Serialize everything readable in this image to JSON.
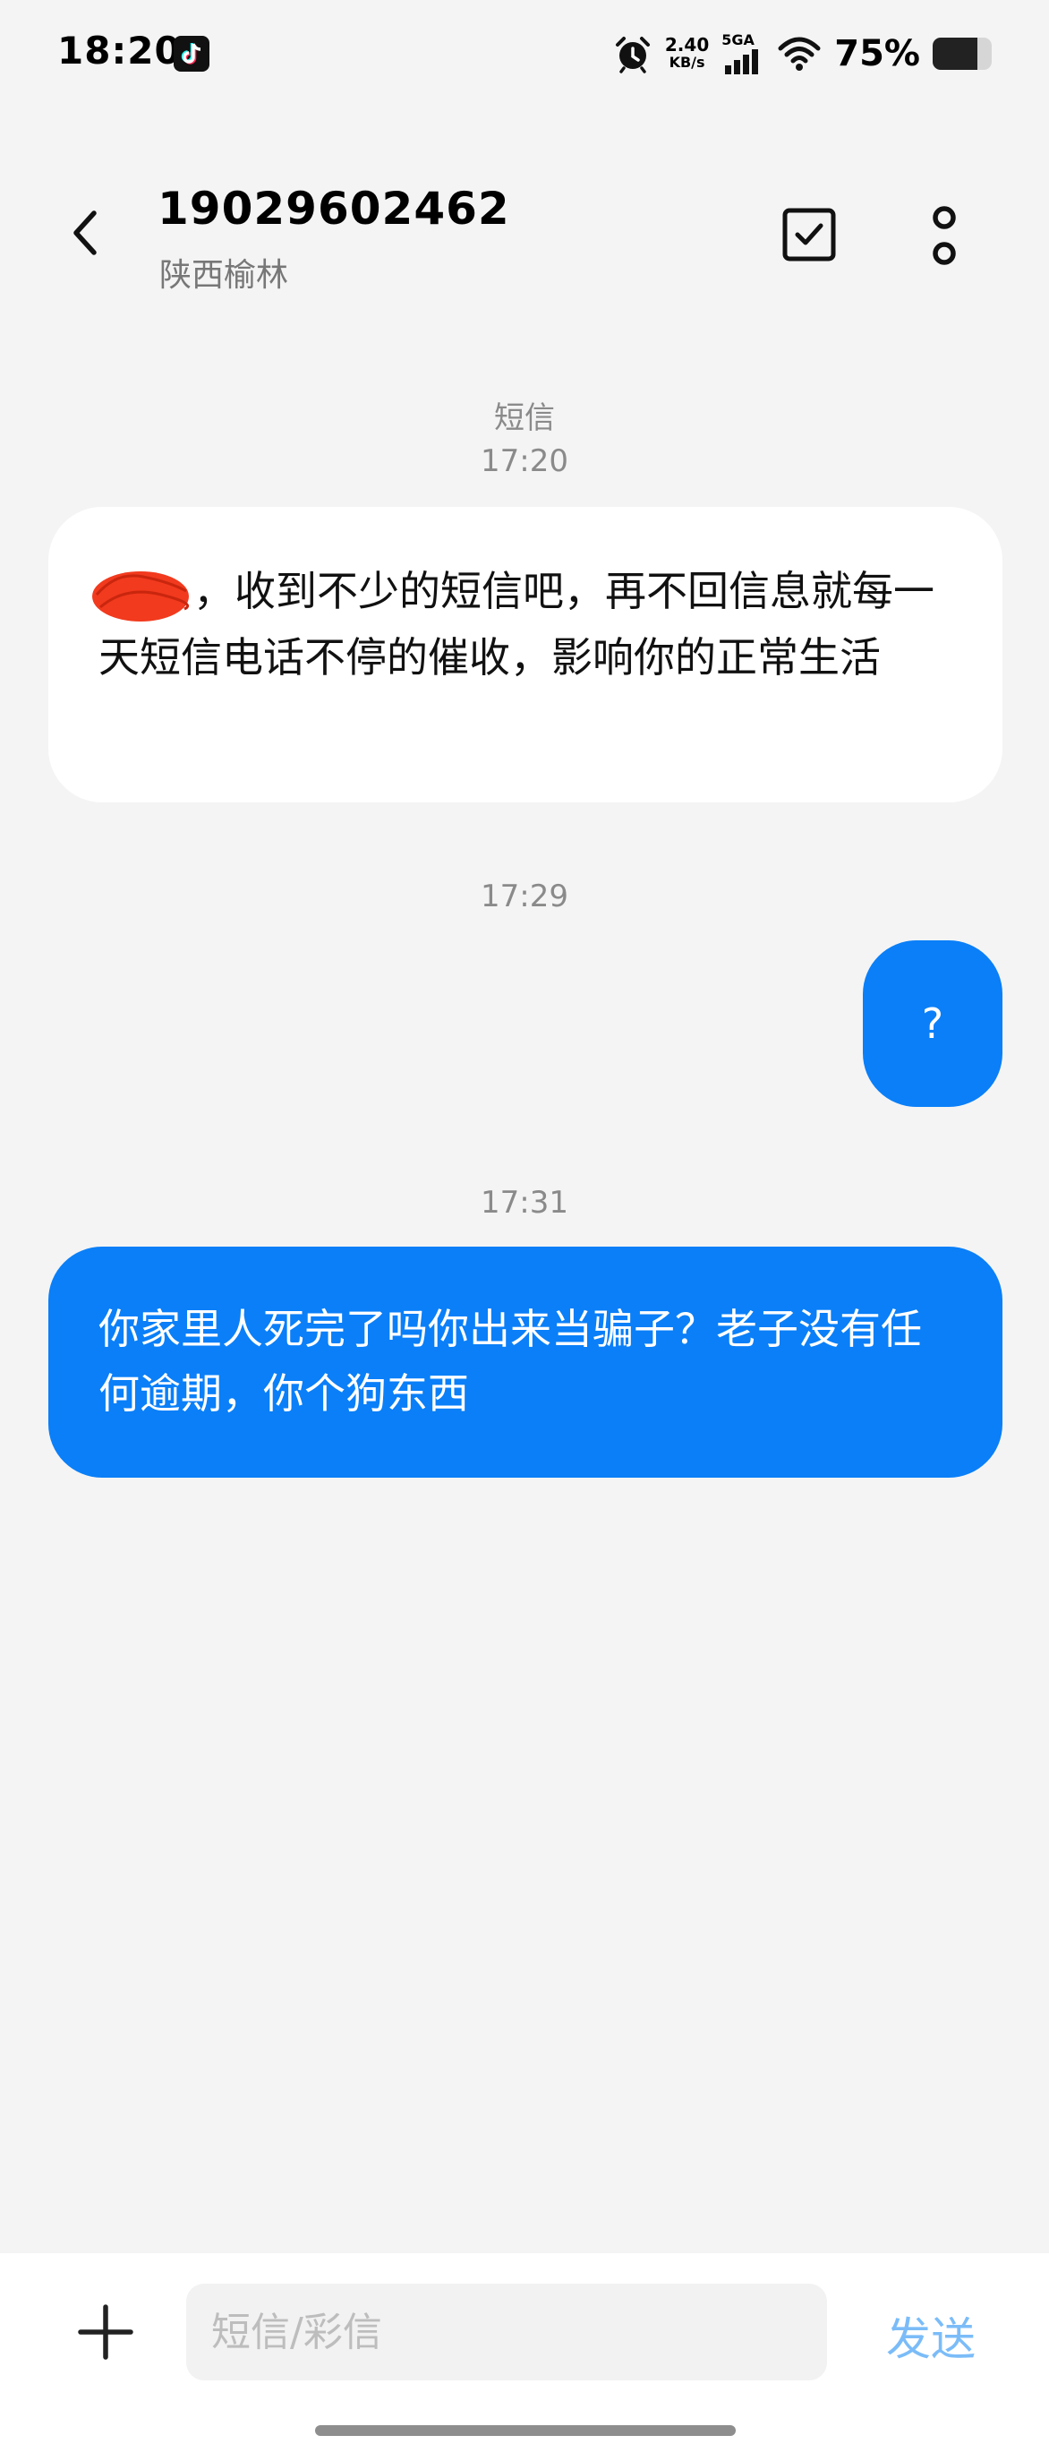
{
  "status_bar": {
    "time": "18:20",
    "net_speed_value": "2.40",
    "net_speed_unit": "KB/s",
    "signal_label": "5GA",
    "battery_percent_text": "75%",
    "battery_level": 0.75
  },
  "header": {
    "contact_number": "19029602462",
    "contact_location": "陕西榆林"
  },
  "messages": {
    "channel_label": "短信",
    "groups": [
      {
        "timestamp": "17:20",
        "direction": "incoming",
        "text": "，收到不少的短信吧，再不回信息就每一天短信电话不停的催收，影响你的正常生活",
        "has_redaction": true
      },
      {
        "timestamp": "17:29",
        "direction": "outgoing",
        "text": "?"
      },
      {
        "timestamp": "17:31",
        "direction": "outgoing",
        "text": "你家里人死完了吗你出来当骗子？老子没有任何逾期，你个狗东西"
      }
    ]
  },
  "compose": {
    "placeholder": "短信/彩信",
    "send_label": "发送"
  },
  "colors": {
    "background": "#f4f4f5",
    "outgoing_bubble": "#0a7ff8",
    "incoming_bubble": "#ffffff",
    "send_disabled": "#7bbcf8",
    "redaction": "#f23a1e"
  }
}
